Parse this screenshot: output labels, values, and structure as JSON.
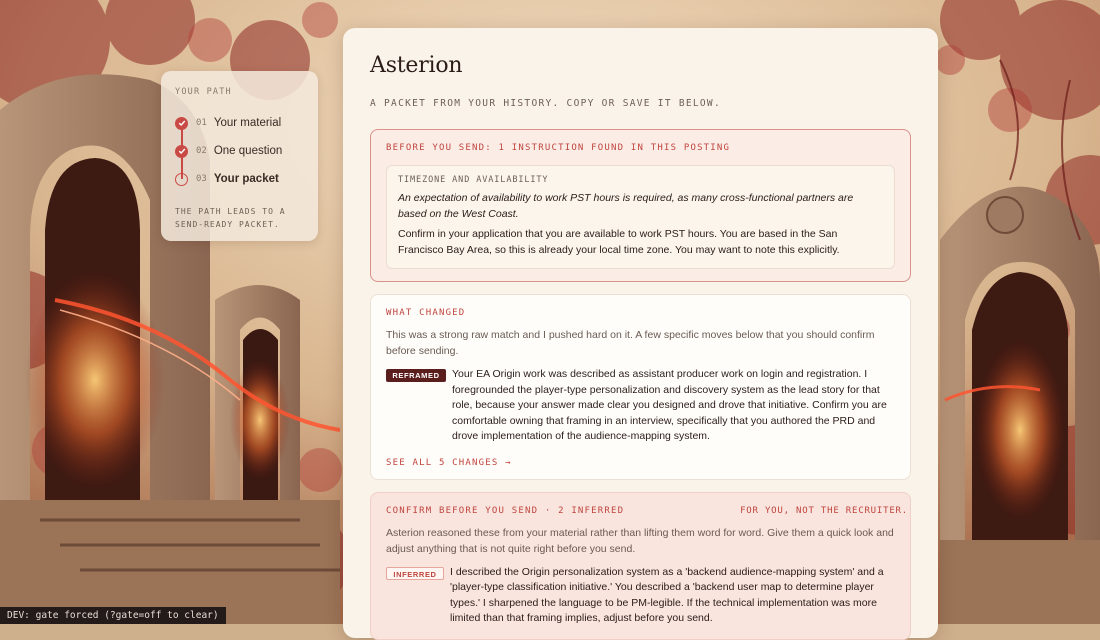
{
  "path": {
    "heading": "YOUR PATH",
    "steps": [
      {
        "num": "01",
        "label": "Your material",
        "status": "done"
      },
      {
        "num": "02",
        "label": "One question",
        "status": "done"
      },
      {
        "num": "03",
        "label": "Your packet",
        "status": "current"
      }
    ],
    "footer": "THE PATH LEADS TO A SEND-READY PACKET."
  },
  "main": {
    "title": "Asterion",
    "subtitle": "A PACKET FROM YOUR HISTORY. COPY OR SAVE IT BELOW.",
    "instruction": {
      "label": "BEFORE YOU SEND: 1 INSTRUCTION FOUND IN THIS POSTING",
      "item_label": "TIMEZONE AND AVAILABILITY",
      "quote": "An expectation of availability to work PST hours is required, as many cross-functional partners are based on the West Coast.",
      "body": "Confirm in your application that you are available to work PST hours. You are based in the San Francisco Bay Area, so this is already your local time zone. You may want to note this explicitly."
    },
    "changed": {
      "label": "WHAT CHANGED",
      "desc": "This was a strong raw match and I pushed hard on it. A few specific moves below that you should confirm before sending.",
      "tag": "REFRAMED",
      "text": "Your EA Origin work was described as assistant producer work on login and registration. I foregrounded the player-type personalization and discovery system as the lead story for that role, because your answer made clear you designed and drove that initiative. Confirm you are comfortable owning that framing in an interview, specifically that you authored the PRD and drove implementation of the audience-mapping system.",
      "see_all": "SEE ALL 5 CHANGES →"
    },
    "confirm": {
      "label": "CONFIRM BEFORE YOU SEND · 2 INFERRED",
      "right_label": "FOR YOU, NOT THE RECRUITER.",
      "desc": "Asterion reasoned these from your material rather than lifting them word for word. Give them a quick look and adjust anything that is not quite right before you send.",
      "tag": "INFERRED",
      "text": "I described the Origin personalization system as a 'backend audience-mapping system' and a 'player-type classification initiative.' You described a 'backend user map to determine player types.' I sharpened the language to be PM-legible. If the technical implementation was more limited than that framing implies, adjust before you send."
    }
  },
  "dev": {
    "text": "DEV: gate forced (?gate=off to clear)"
  },
  "colors": {
    "accent": "#c94a44",
    "card": "#faf3ea",
    "tag_dark": "#5a1f1d"
  }
}
